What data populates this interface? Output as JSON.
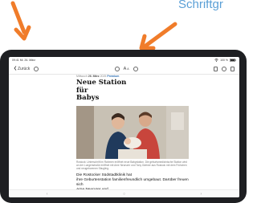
{
  "caption_text": "Schriftgr",
  "status": {
    "time": "09:41 Mi. 26. März",
    "battery": "100 %"
  },
  "toolbar": {
    "back_label": "Zurück",
    "font_size_label": "A",
    "font_size_sup": "A"
  },
  "article": {
    "source": "Mittwoch",
    "date": "26. März",
    "year": "2025",
    "premium": "Premium",
    "headline_lines": [
      "Neue Station",
      "für",
      "Babys"
    ],
    "photo_caption": "Rostock: Unterschrift im Rahmen eröffnet neue Babystation. Die geburtsmedizinische Station wird an der Lungenstraße eröffnet mit Arne Neururer und Tony Gärtner aus Rostock mit dem Frühchen und neugeborenen Säugling.",
    "lead_lines": [
      "Die Rostocker Südstadtklinik hat",
      "ihre Geburtenstation familienfreundlich umgebaut. Darüber freuen sich",
      "Arne Neururer und",
      "Tony Gärtner"
    ]
  },
  "colors": {
    "caption_blue": "#5a9fd6",
    "arrow_orange": "#f07c2a",
    "device": "#1e1f22"
  },
  "icons": {
    "back": "chevron-left-icon",
    "reload": "refresh-icon",
    "history": "clock-icon",
    "font_size": "text-size-icon",
    "add": "plus-circle-icon",
    "share": "share-icon",
    "print": "printer-icon",
    "bookmark": "bookmark-icon"
  }
}
